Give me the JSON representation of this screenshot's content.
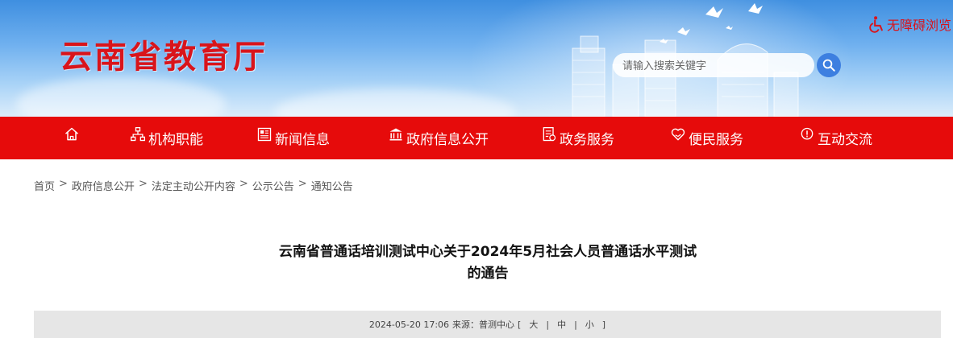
{
  "header": {
    "site_title": "云南省教育厅",
    "accessibility_label": "无障碍浏览",
    "search_placeholder": "请输入搜索关键字"
  },
  "nav": {
    "items": [
      {
        "label": "",
        "icon": "home-icon"
      },
      {
        "label": "机构职能",
        "icon": "org-chart-icon"
      },
      {
        "label": "新闻信息",
        "icon": "newspaper-icon"
      },
      {
        "label": "政府信息公开",
        "icon": "government-building-icon"
      },
      {
        "label": "政务服务",
        "icon": "service-document-icon"
      },
      {
        "label": "便民服务",
        "icon": "heart-hand-icon"
      },
      {
        "label": "互动交流",
        "icon": "chat-icon"
      }
    ]
  },
  "breadcrumb": {
    "items": [
      "首页",
      "政府信息公开",
      "法定主动公开内容",
      "公示公告",
      "通知公告"
    ],
    "separator": ">"
  },
  "article": {
    "title_line1": "云南省普通话培训测试中心关于2024年5月社会人员普通话水平测试",
    "title_line2": "的通告",
    "date": "2024-05-20 17:06",
    "source": "来源：普测中心",
    "font_size_open": "[",
    "font_size_large": "大",
    "font_size_medium": "中",
    "font_size_small": "小",
    "font_size_close": "]",
    "divider": "|"
  },
  "colors": {
    "brand_red": "#e60b0b",
    "logo_red": "#d9141b",
    "search_button": "#3d7fe0"
  }
}
